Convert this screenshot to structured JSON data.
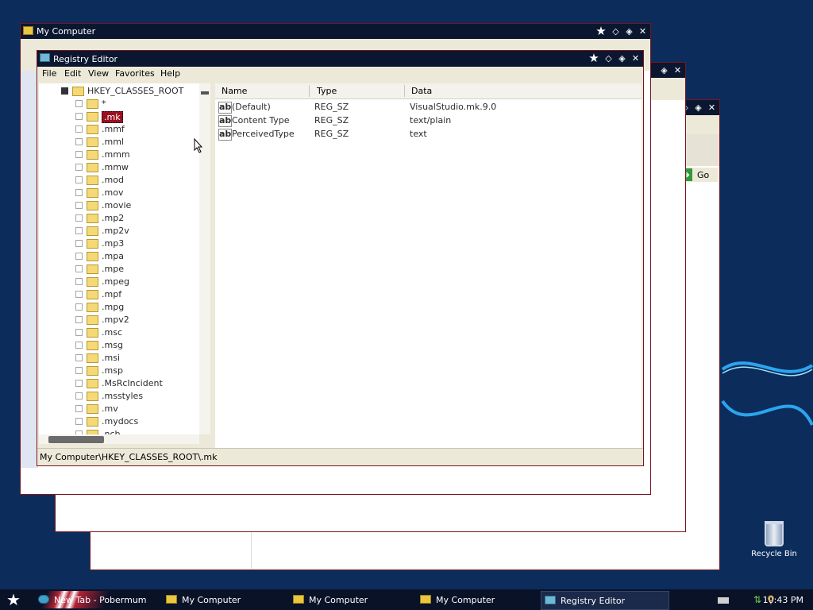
{
  "desktop": {
    "recycle_bin_label": "Recycle Bin"
  },
  "windows": {
    "back_window_title": "My Computer"
  },
  "registry": {
    "title": "Registry Editor",
    "menu": [
      "File",
      "Edit",
      "View",
      "Favorites",
      "Help"
    ],
    "tree": {
      "root": "HKEY_CLASSES_ROOT",
      "items": [
        ".mmf",
        ".mml",
        ".mmm",
        ".mmw",
        ".mod",
        ".mov",
        ".movie",
        ".mp2",
        ".mp2v",
        ".mp3",
        ".mpa",
        ".mpe",
        ".mpeg",
        ".mpf",
        ".mpg",
        ".mpv2",
        ".msc",
        ".msg",
        ".msi",
        ".msp",
        ".MsRcIncident",
        ".msstyles",
        ".mv",
        ".mydocs",
        ".ncb"
      ],
      "first": "*",
      "selected": ".mk"
    },
    "columns": {
      "name": "Name",
      "type": "Type",
      "data": "Data"
    },
    "values": [
      {
        "name": "(Default)",
        "type": "REG_SZ",
        "data": "VisualStudio.mk.9.0"
      },
      {
        "name": "Content Type",
        "type": "REG_SZ",
        "data": "text/plain"
      },
      {
        "name": "PerceivedType",
        "type": "REG_SZ",
        "data": "text"
      }
    ],
    "status": "My Computer\\HKEY_CLASSES_ROOT\\.mk"
  },
  "browser": {
    "go_label": "Go"
  },
  "taskbar": {
    "tasks": [
      "New Tab - Pobermum",
      "My Computer",
      "My Computer",
      "My Computer",
      "Registry Editor"
    ],
    "clock": "10:43 PM"
  },
  "colors": {
    "desktop": "#0c2d5c",
    "title": "#0b1730",
    "accent": "#9b1020"
  }
}
